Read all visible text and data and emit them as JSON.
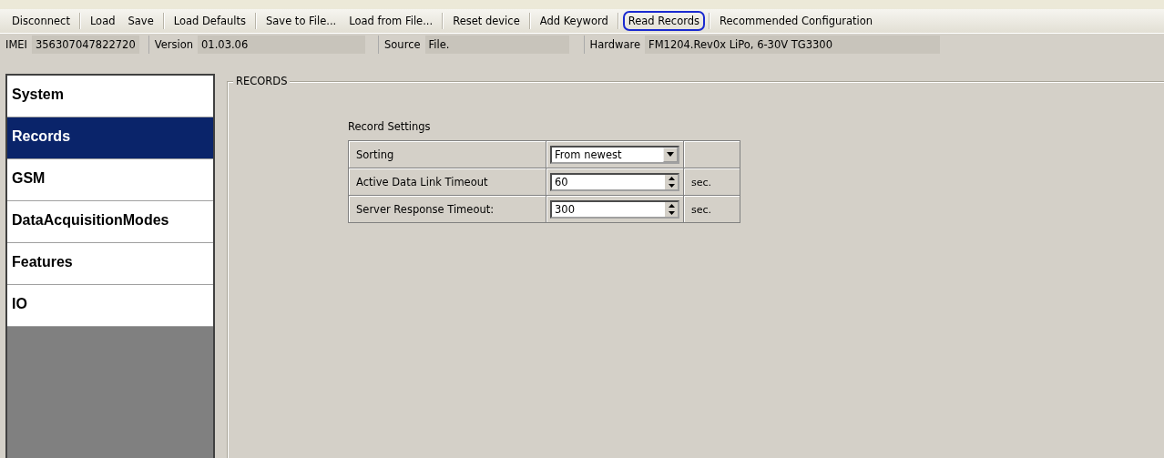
{
  "toolbar": {
    "groups": [
      [
        {
          "label": "Disconnect",
          "highlighted": false
        }
      ],
      [
        {
          "label": "Load",
          "highlighted": false
        },
        {
          "label": "Save",
          "highlighted": false
        }
      ],
      [
        {
          "label": "Load Defaults",
          "highlighted": false
        }
      ],
      [
        {
          "label": "Save to File...",
          "highlighted": false
        },
        {
          "label": "Load from File...",
          "highlighted": false
        }
      ],
      [
        {
          "label": "Reset device",
          "highlighted": false
        }
      ],
      [
        {
          "label": "Add Keyword",
          "highlighted": false
        }
      ],
      [
        {
          "label": "Read Records",
          "highlighted": true
        }
      ],
      [
        {
          "label": "Recommended Configuration",
          "highlighted": false
        }
      ]
    ]
  },
  "info_bar": [
    {
      "label": "IMEI",
      "value": "356307047822720"
    },
    {
      "label": "Version",
      "value": "01.03.06"
    },
    {
      "label": "Source",
      "value": "File."
    },
    {
      "label": "Hardware",
      "value": "FM1204.Rev0x LiPo, 6-30V TG3300"
    }
  ],
  "sidebar": {
    "items": [
      {
        "label": "System",
        "selected": false
      },
      {
        "label": "Records",
        "selected": true
      },
      {
        "label": "GSM",
        "selected": false
      },
      {
        "label": "DataAcquisitionModes",
        "selected": false
      },
      {
        "label": "Features",
        "selected": false
      },
      {
        "label": "IO",
        "selected": false
      }
    ]
  },
  "group": {
    "title": "RECORDS",
    "section": "Record Settings",
    "rows": [
      {
        "kind": "dropdown",
        "label": "Sorting",
        "value": "From newest"
      },
      {
        "kind": "spinner",
        "label": "Active Data Link Timeout",
        "value": "60",
        "unit": "sec."
      },
      {
        "kind": "spinner",
        "label": "Server Response Timeout:",
        "value": "300",
        "unit": "sec."
      }
    ]
  }
}
